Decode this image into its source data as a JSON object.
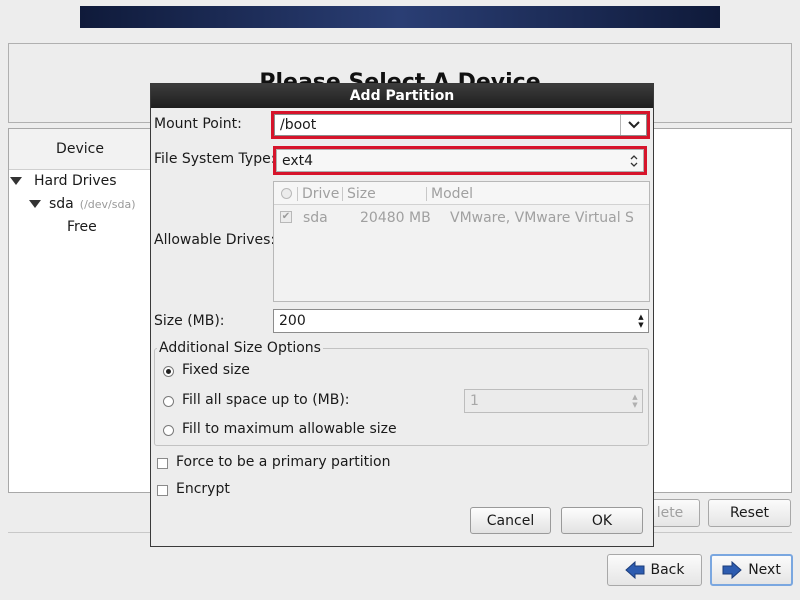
{
  "background": {
    "heading": "Please Select A Device",
    "device_column": "Device",
    "tree": {
      "hard_drives": "Hard Drives",
      "disk_name": "sda",
      "disk_path": "/dev/sda",
      "free": "Free"
    },
    "buttons": {
      "delete_partial": "lete",
      "reset": "Reset",
      "back": "Back",
      "next": "Next"
    }
  },
  "dialog": {
    "title": "Add Partition",
    "mount_point": {
      "label": "Mount Point:",
      "value": "/boot"
    },
    "fs_type": {
      "label": "File System Type:",
      "value": "ext4"
    },
    "allowable_drives": {
      "label": "Allowable Drives:",
      "columns": [
        "Drive",
        "Size",
        "Model"
      ],
      "rows": [
        {
          "drive": "sda",
          "size": "20480 MB",
          "model": "VMware, VMware Virtual S",
          "checked": true
        }
      ]
    },
    "size": {
      "label": "Size (MB):",
      "value": "200"
    },
    "size_options": {
      "title": "Additional Size Options",
      "fixed": "Fixed size",
      "fill_up_to": "Fill all space up to (MB):",
      "fill_up_to_value": "1",
      "fill_max": "Fill to maximum allowable size",
      "selected": "fixed"
    },
    "primary": {
      "label": "Force to be a primary partition",
      "checked": false
    },
    "encrypt": {
      "label": "Encrypt",
      "checked": false
    },
    "buttons": {
      "cancel": "Cancel",
      "ok": "OK"
    }
  },
  "colors": {
    "highlight": "#d6142b",
    "titlebar": "#2a2a2a",
    "nav_arrow": "#2d5cb0"
  }
}
